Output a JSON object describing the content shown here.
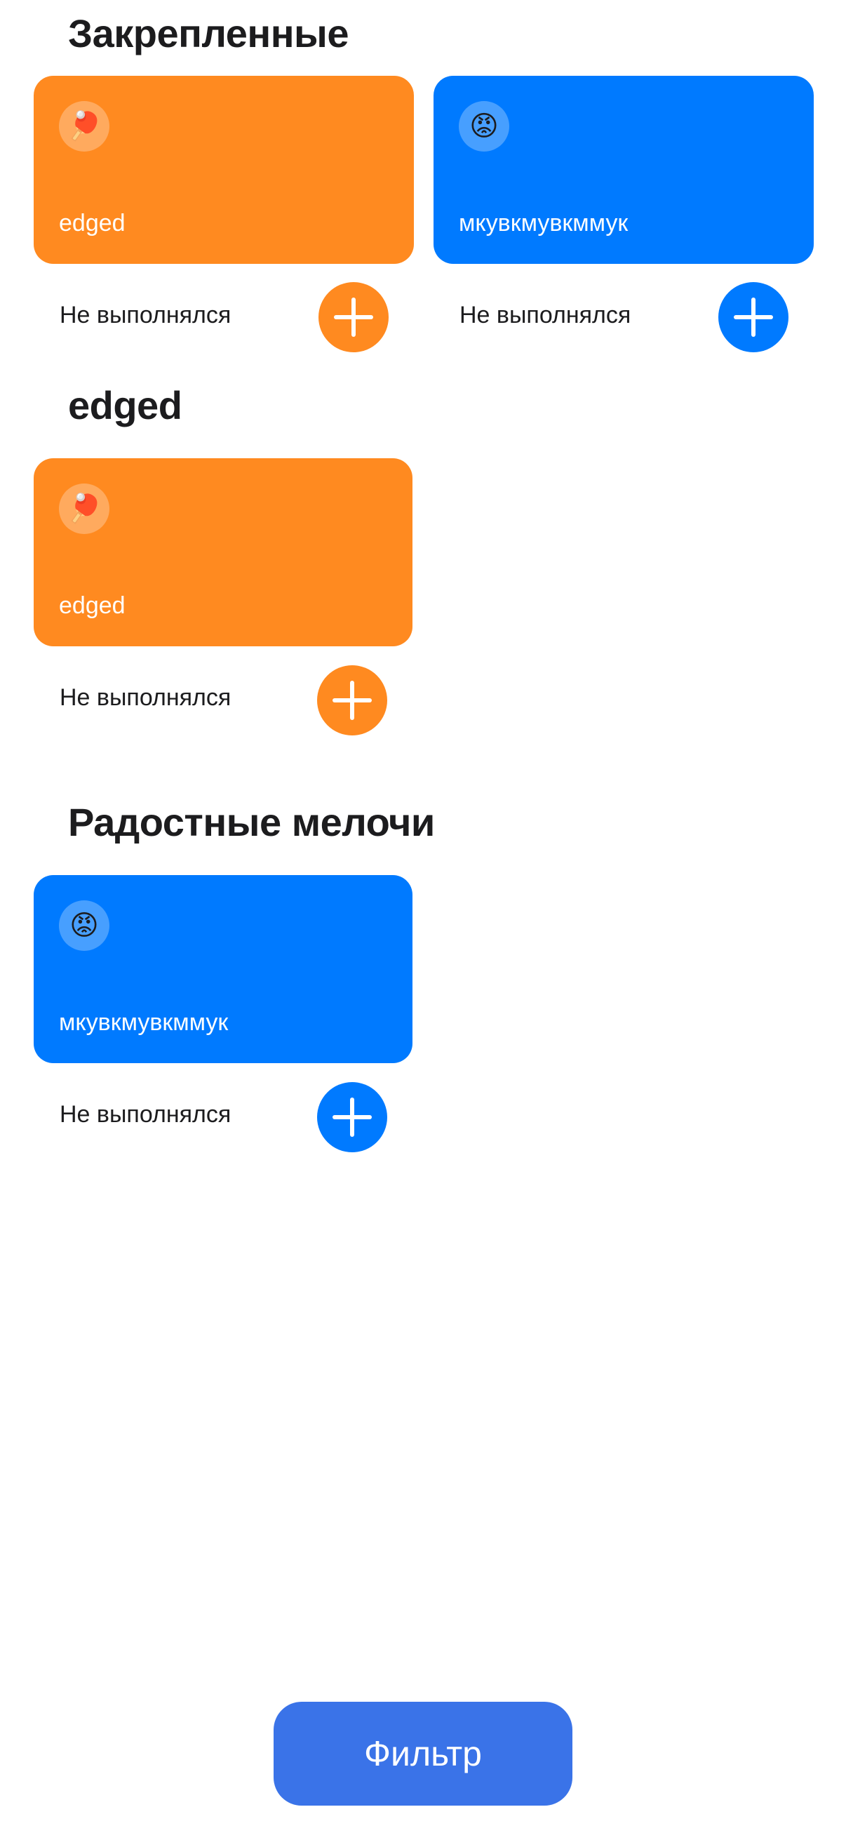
{
  "colors": {
    "orange": "#FF8A20",
    "blue": "#007AFF",
    "filter_button": "#3A73E8"
  },
  "sections": [
    {
      "title": "Закрепленные",
      "habits": [
        {
          "name": "edged",
          "emoji": "🏓",
          "icon": "ping-pong-icon",
          "status": "Не выполнялся",
          "color": "orange"
        },
        {
          "name": "мкувкмувкммук",
          "emoji": "😡",
          "icon": "angry-face-icon",
          "status": "Не выполнялся",
          "color": "blue"
        }
      ]
    },
    {
      "title": "edged",
      "habits": [
        {
          "name": "edged",
          "emoji": "🏓",
          "icon": "ping-pong-icon",
          "status": "Не выполнялся",
          "color": "orange"
        }
      ]
    },
    {
      "title": "Радостные мелочи",
      "habits": [
        {
          "name": "мкувкмувкммук",
          "emoji": "😡",
          "icon": "angry-face-icon",
          "status": "Не выполнялся",
          "color": "blue"
        }
      ]
    }
  ],
  "filter_button": {
    "label": "Фильтр"
  }
}
